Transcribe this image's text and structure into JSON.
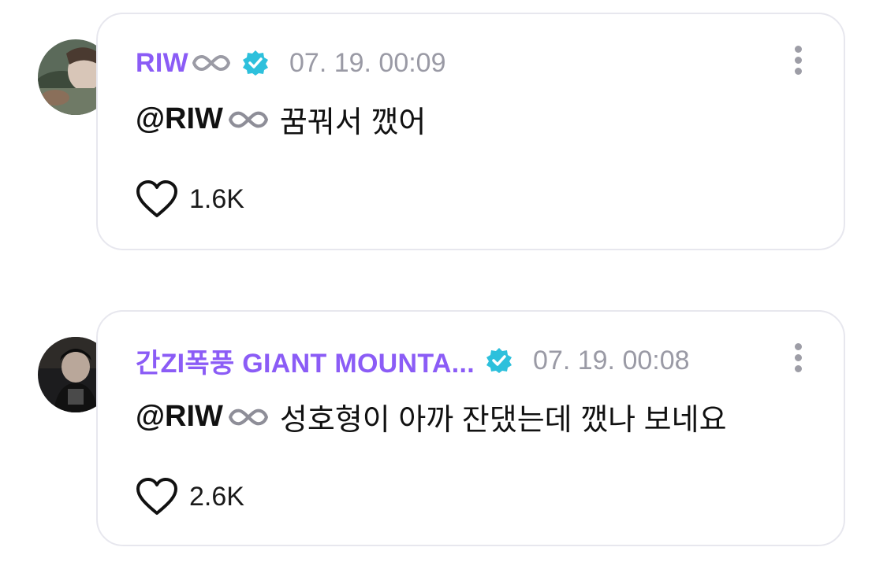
{
  "comments": [
    {
      "author": "RIW",
      "timestamp": "07. 19. 00:09",
      "mention": "@RIW",
      "text": "꿈꿔서 깼어",
      "likes": "1.6K",
      "verified_icon": "verified-badge-icon",
      "author_suffix_icon": "infinity-icon"
    },
    {
      "author": "간ZI폭풍 GIANT MOUNTA...",
      "timestamp": "07. 19. 00:08",
      "mention": "@RIW",
      "text": "성호형이 아까 잔댔는데 깼나 보네요",
      "likes": "2.6K",
      "verified_icon": "verified-badge-icon",
      "author_suffix_icon": ""
    }
  ],
  "colors": {
    "accent": "#8b5cf6",
    "verified": "#2dc0dc",
    "timestamp": "#9a9aa5",
    "border": "#e7e7ee"
  }
}
